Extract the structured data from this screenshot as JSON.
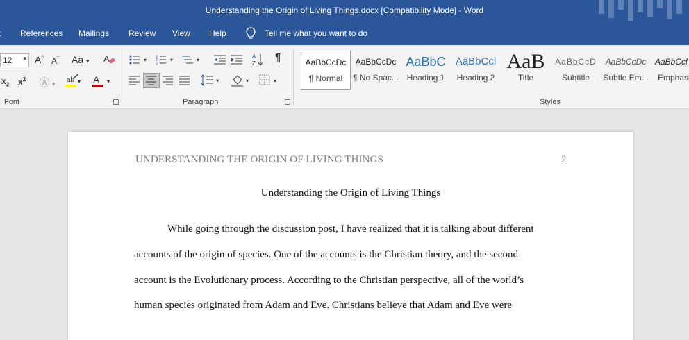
{
  "titlebar": {
    "title": "Understanding the Origin of Living Things.docx [Compatibility Mode]  -  Word"
  },
  "menubar": {
    "tabs": [
      {
        "label": "t"
      },
      {
        "label": "References"
      },
      {
        "label": "Mailings"
      },
      {
        "label": "Review"
      },
      {
        "label": "View"
      },
      {
        "label": "Help"
      }
    ],
    "tell_me": "Tell me what you want to do"
  },
  "ribbon": {
    "font": {
      "size": "12",
      "change_case": "Aa",
      "group_label": "Font"
    },
    "paragraph": {
      "group_label": "Paragraph"
    },
    "styles": {
      "group_label": "Styles",
      "items": [
        {
          "sample": "AaBbCcDc",
          "name": "¶ Normal"
        },
        {
          "sample": "AaBbCcDc",
          "name": "¶ No Spac..."
        },
        {
          "sample": "AaBbC",
          "name": "Heading 1"
        },
        {
          "sample": "AaBbCcl",
          "name": "Heading 2"
        },
        {
          "sample": "AaB",
          "name": "Title"
        },
        {
          "sample": "AaBbCcD",
          "name": "Subtitle"
        },
        {
          "sample": "AaBbCcDc",
          "name": "Subtle Em..."
        },
        {
          "sample": "AaBbCcl",
          "name": "Emphasis"
        }
      ]
    },
    "colors": {
      "highlight": "#ffff00",
      "font_color": "#c00000"
    }
  },
  "document": {
    "header": "UNDERSTANDING THE ORIGIN OF LIVING THINGS",
    "page_number": "2",
    "title": "Understanding the Origin of Living Things",
    "lines": [
      "While going through the discussion post, I have realized that it is talking about different",
      "accounts of the origin of species. One of the accounts is the Christian theory, and the second",
      "account is the Evolutionary process. According to the Christian perspective, all of the world’s",
      "human species originated from Adam and Eve. Christians believe that Adam and Eve were"
    ]
  },
  "colors": {
    "titlebar": "#2b579a",
    "ribbon": "#f3f3f3",
    "canvas": "#e6e6e6"
  }
}
